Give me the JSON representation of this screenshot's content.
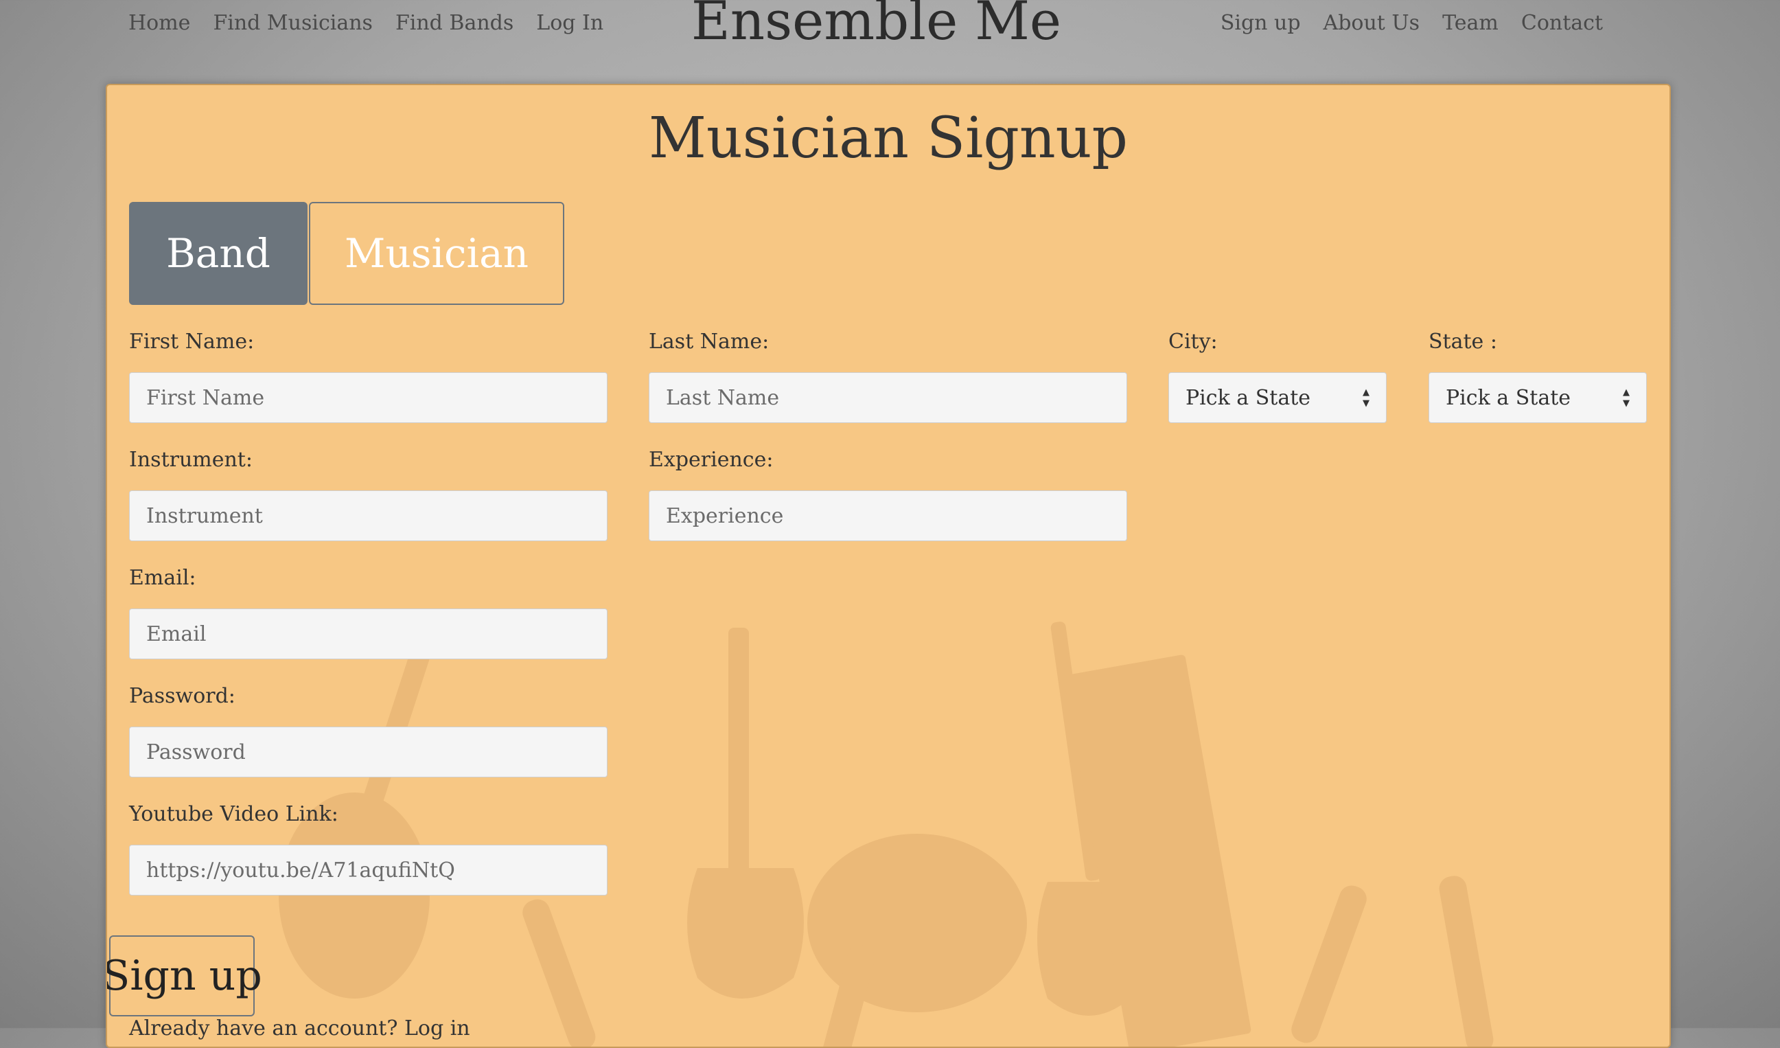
{
  "nav": {
    "left": [
      "Home",
      "Find Musicians",
      "Find Bands",
      "Log In"
    ],
    "brand": "Ensemble Me",
    "right": [
      "Sign up",
      "About Us",
      "Team",
      "Contact"
    ]
  },
  "form": {
    "title": "Musician Signup",
    "toggle": {
      "band": "Band",
      "musician": "Musician",
      "active": "Band"
    },
    "first_name": {
      "label": "First Name:",
      "placeholder": "First Name"
    },
    "last_name": {
      "label": "Last Name:",
      "placeholder": "Last Name"
    },
    "city": {
      "label": "City:",
      "selected": "Pick a State"
    },
    "state": {
      "label": "State :",
      "selected": "Pick a State"
    },
    "instrument": {
      "label": "Instrument:",
      "placeholder": "Instrument"
    },
    "experience": {
      "label": "Experience:",
      "placeholder": "Experience"
    },
    "email": {
      "label": "Email:",
      "placeholder": "Email"
    },
    "password": {
      "label": "Password:",
      "placeholder": "Password"
    },
    "youtube": {
      "label": "Youtube Video Link:",
      "placeholder": "https://youtu.be/A71aqufiNtQ"
    },
    "submit_label": "Sign up",
    "footer_partial": "Already have an account? Log in"
  },
  "colors": {
    "card": "#f7c784",
    "toggle_active": "#6c757d",
    "background": "#a6a6a6"
  }
}
